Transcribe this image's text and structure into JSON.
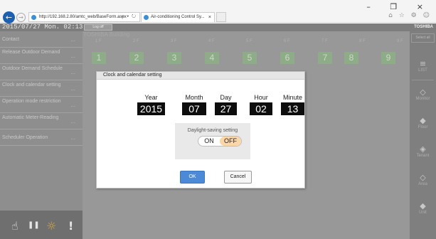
{
  "browser": {
    "url": "http://192.168.2.80/amtc_web/BaseForm.aspx",
    "addr_tools": "⌕ ▾ ↻",
    "tab_title": "Air-conditioning Control Sy...",
    "tab_close": "×",
    "window_controls": "– ❐ ×",
    "toolbar_icons": "⌂ ☆ ⚙ ☺",
    "icons": {
      "back": "back-arrow-icon",
      "forward": "forward-arrow-icon"
    }
  },
  "app": {
    "datetime": "2015/07/27  Mon.  02:13",
    "logout_label": "Log off",
    "brand": "TOSHIBA",
    "building": "TOSHIBA Building",
    "menu": [
      {
        "label": "Contact",
        "dots": "..."
      },
      {
        "label": "Release Outdoor Demand",
        "dots": "..."
      },
      {
        "label": "Outdoor Demand Schedule",
        "dots": "..."
      },
      {
        "label": "Clock and calendar setting",
        "dots": "..."
      },
      {
        "label": "Operation mode restriction",
        "dots": "..."
      },
      {
        "label": "Automatic Meter-Reading",
        "dots": "..."
      },
      {
        "label": "Scheduler Operation",
        "dots": "..."
      }
    ],
    "floor_labels": [
      "1 F",
      "2 F",
      "3 F",
      "4 F",
      "5 F",
      "6 F",
      "7 F",
      "8 F",
      "9 F"
    ],
    "floors": [
      "1",
      "2",
      "3",
      "4",
      "5",
      "6",
      "7",
      "8",
      "9"
    ],
    "bottom_icons": [
      "☝",
      "❚❚",
      "☼",
      "!"
    ],
    "right": {
      "select_all": "Select all",
      "items": [
        {
          "label": "LIST",
          "icon": "≡"
        },
        {
          "label": "Monitor",
          "icon": "◇"
        },
        {
          "label": "Floor",
          "icon": "◆"
        },
        {
          "label": "Tenant",
          "icon": "◈"
        },
        {
          "label": "Area",
          "icon": "◇"
        },
        {
          "label": "Unit",
          "icon": "◆"
        }
      ]
    }
  },
  "dialog": {
    "title": "Clock and calendar setting",
    "fields": [
      {
        "label": "Year",
        "value": "2015"
      },
      {
        "label": "Month",
        "value": "07"
      },
      {
        "label": "Day",
        "value": "27"
      },
      {
        "label": "Hour",
        "value": "02"
      },
      {
        "label": "Minute",
        "value": "13"
      }
    ],
    "dst_label": "Daylight-saving setting",
    "dst_on": "ON",
    "dst_off": "OFF",
    "dst_selected": "OFF",
    "ok_label": "OK",
    "cancel_label": "Cancel"
  }
}
